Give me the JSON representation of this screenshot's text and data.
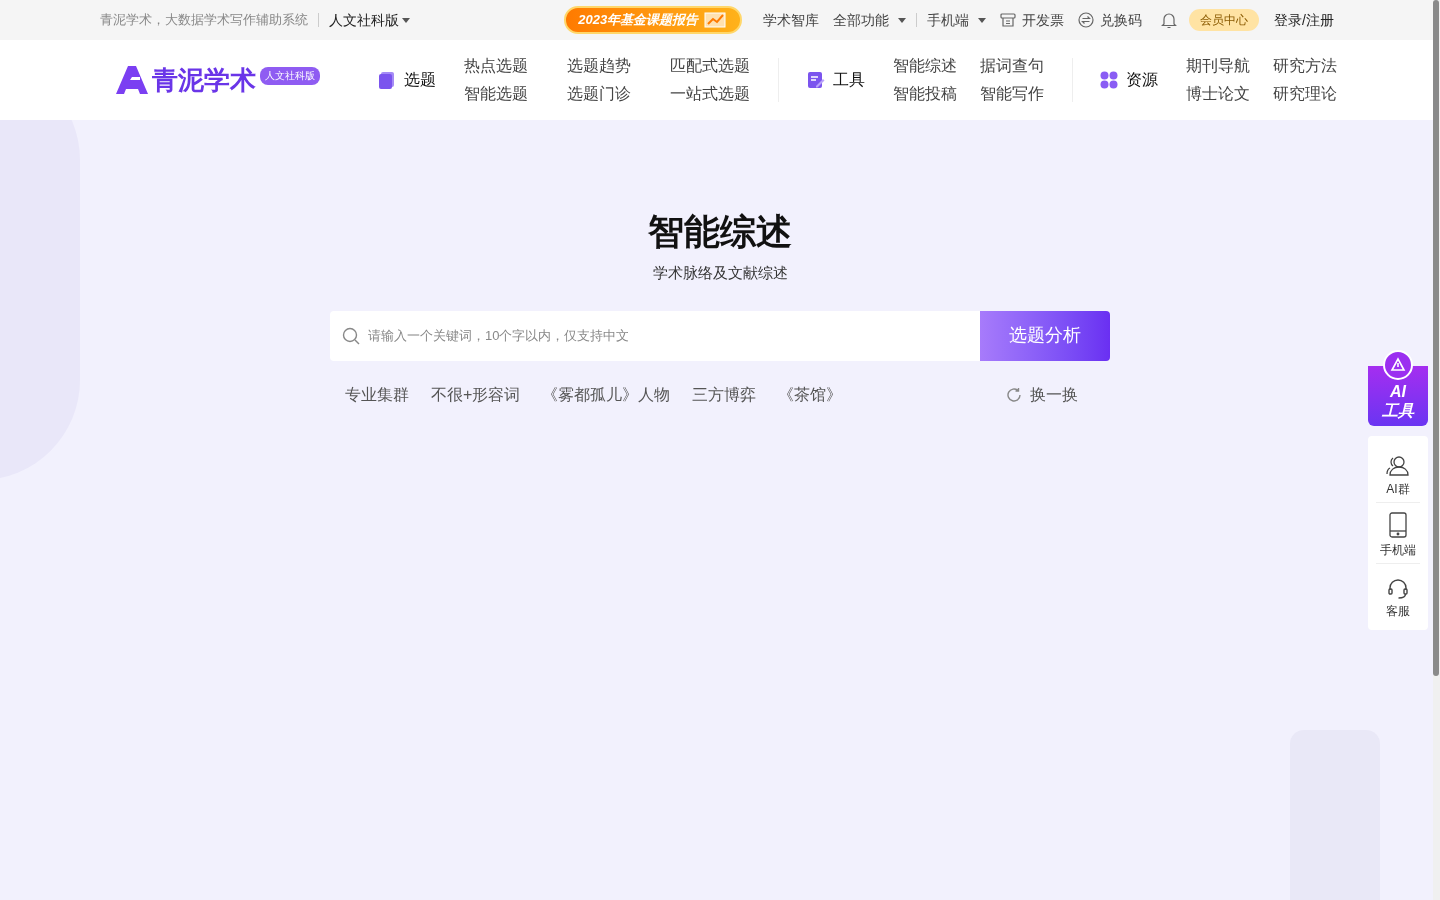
{
  "top_bar": {
    "tagline": "青泥学术，大数据学术写作辅助系统",
    "edition": "人文社科版",
    "banner": "2023年基金课题报告",
    "links": [
      {
        "label": "学术智库",
        "kind": "plain"
      },
      {
        "label": "全部功能",
        "kind": "dropdown"
      },
      {
        "label": "手机端",
        "kind": "dropdown"
      },
      {
        "label": "开发票",
        "kind": "invoice"
      },
      {
        "label": "兑换码",
        "kind": "redeem"
      }
    ],
    "member": "会员中心",
    "login": "登录/注册"
  },
  "nav": {
    "logo": "青泥学术",
    "badge": "人文社科版",
    "groups": [
      {
        "title": "选题",
        "kind": "book",
        "items": [
          "热点选题",
          "选题趋势",
          "匹配式选题",
          "智能选题",
          "选题门诊",
          "一站式选题"
        ]
      },
      {
        "title": "工具",
        "kind": "edit",
        "items": [
          "智能综述",
          "据词查句",
          "智能投稿",
          "智能写作"
        ]
      },
      {
        "title": "资源",
        "kind": "grid",
        "items": [
          "期刊导航",
          "研究方法",
          "博士论文",
          "研究理论"
        ]
      }
    ]
  },
  "hero": {
    "title": "智能综述",
    "subtitle": "学术脉络及文献综述",
    "search": {
      "placeholder": "请输入一个关键词，10个字以内，仅支持中文"
    },
    "button": "选题分析",
    "tags": [
      "专业集群",
      "不很+形容词",
      "《雾都孤儿》人物",
      "三方博弈",
      "《茶馆》"
    ],
    "refresh": "换一换"
  },
  "side_panel": {
    "ai_tool": [
      "AI",
      "工具"
    ],
    "items": [
      {
        "label": "AI群",
        "kind": "group"
      },
      {
        "label": "手机端",
        "kind": "phone"
      },
      {
        "label": "客服",
        "kind": "headset"
      }
    ]
  }
}
